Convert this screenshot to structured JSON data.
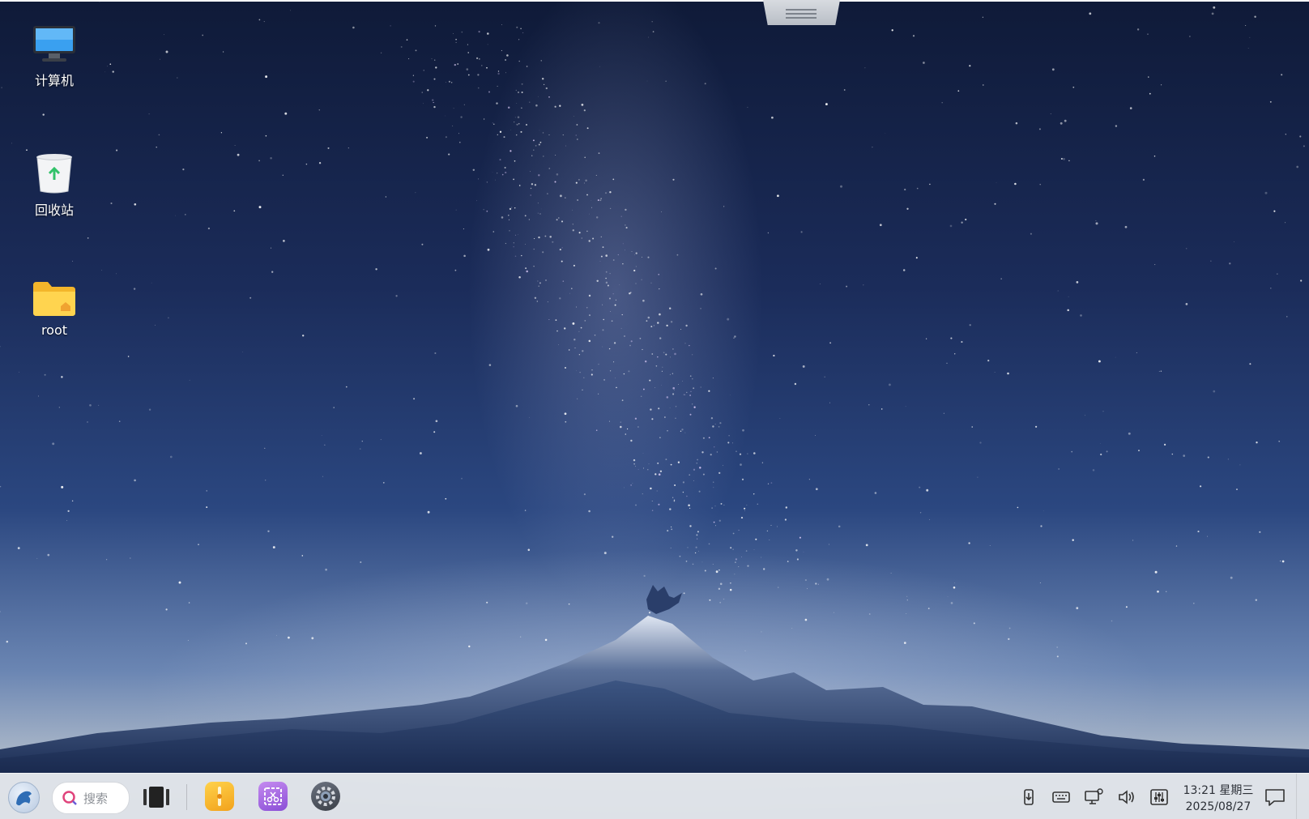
{
  "desktop": {
    "icons": [
      {
        "label": "计算机",
        "icon": "computer-icon"
      },
      {
        "label": "回收站",
        "icon": "trash-icon"
      },
      {
        "label": "root",
        "icon": "home-folder-icon"
      }
    ]
  },
  "taskbar": {
    "launcher_icon": "launcher-icon",
    "search_placeholder": "搜索",
    "apps": [
      {
        "name": "file-manager",
        "icon": "file-manager-icon",
        "color": "#f5b021"
      },
      {
        "name": "screenshot",
        "icon": "screenshot-icon",
        "color": "#a86be6"
      },
      {
        "name": "settings",
        "icon": "settings-icon",
        "color": "#4a4f58"
      }
    ],
    "tray": [
      "usb-icon",
      "keyboard-icon",
      "network-icon",
      "volume-icon",
      "mixer-icon"
    ],
    "clock": {
      "time": "13:21 星期三",
      "date": "2025/08/27"
    },
    "notification_icon": "notification-icon"
  }
}
